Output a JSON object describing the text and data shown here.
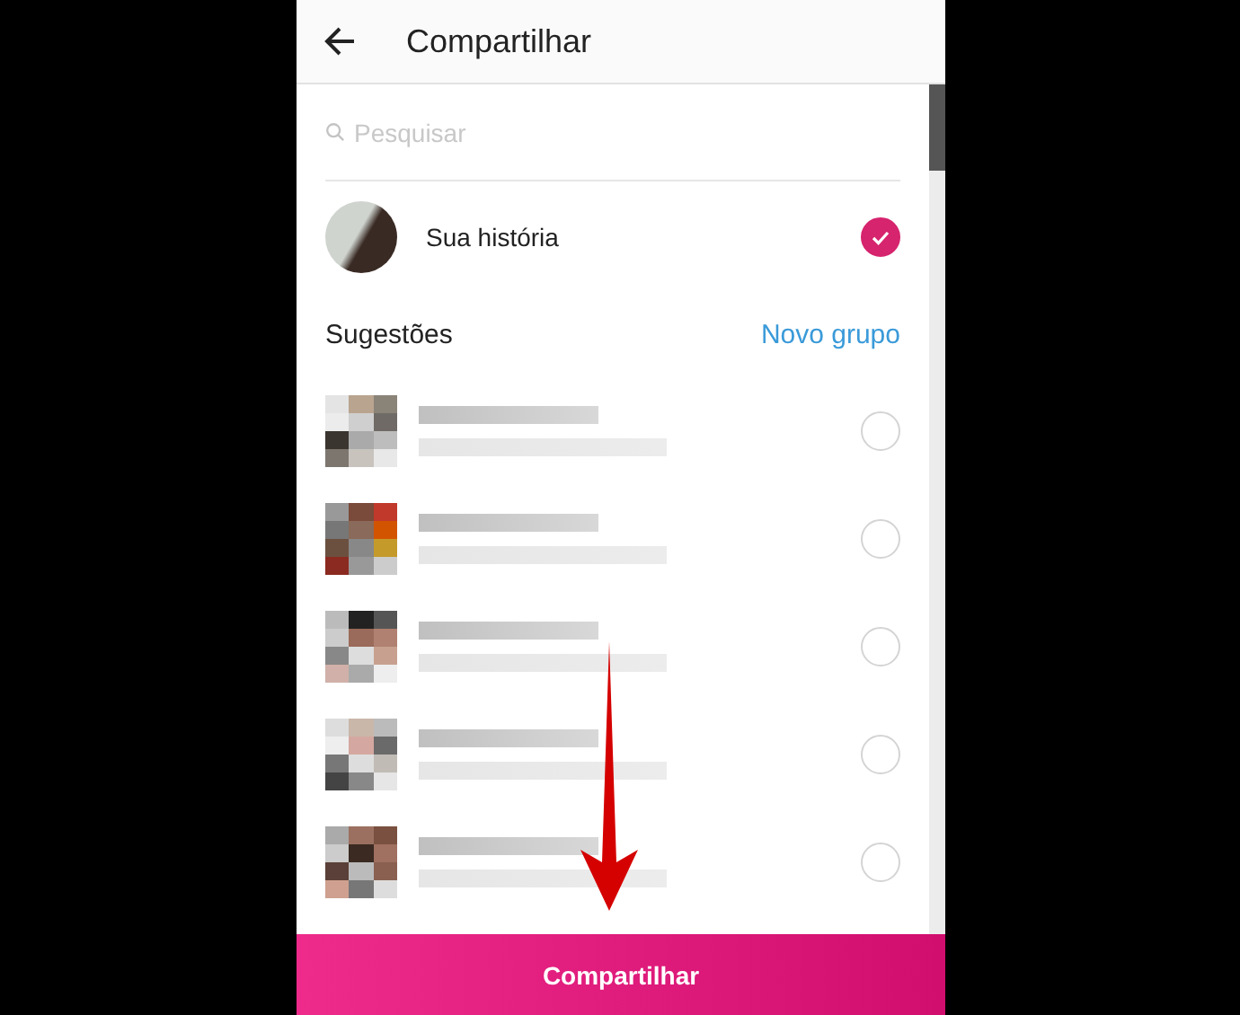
{
  "header": {
    "title": "Compartilhar"
  },
  "search": {
    "placeholder": "Pesquisar"
  },
  "story": {
    "label": "Sua história",
    "selected": true
  },
  "suggestions": {
    "title": "Sugestões",
    "action": "Novo grupo",
    "items": [
      {
        "selected": false
      },
      {
        "selected": false
      },
      {
        "selected": false
      },
      {
        "selected": false
      },
      {
        "selected": false
      }
    ]
  },
  "share_button": "Compartilhar"
}
